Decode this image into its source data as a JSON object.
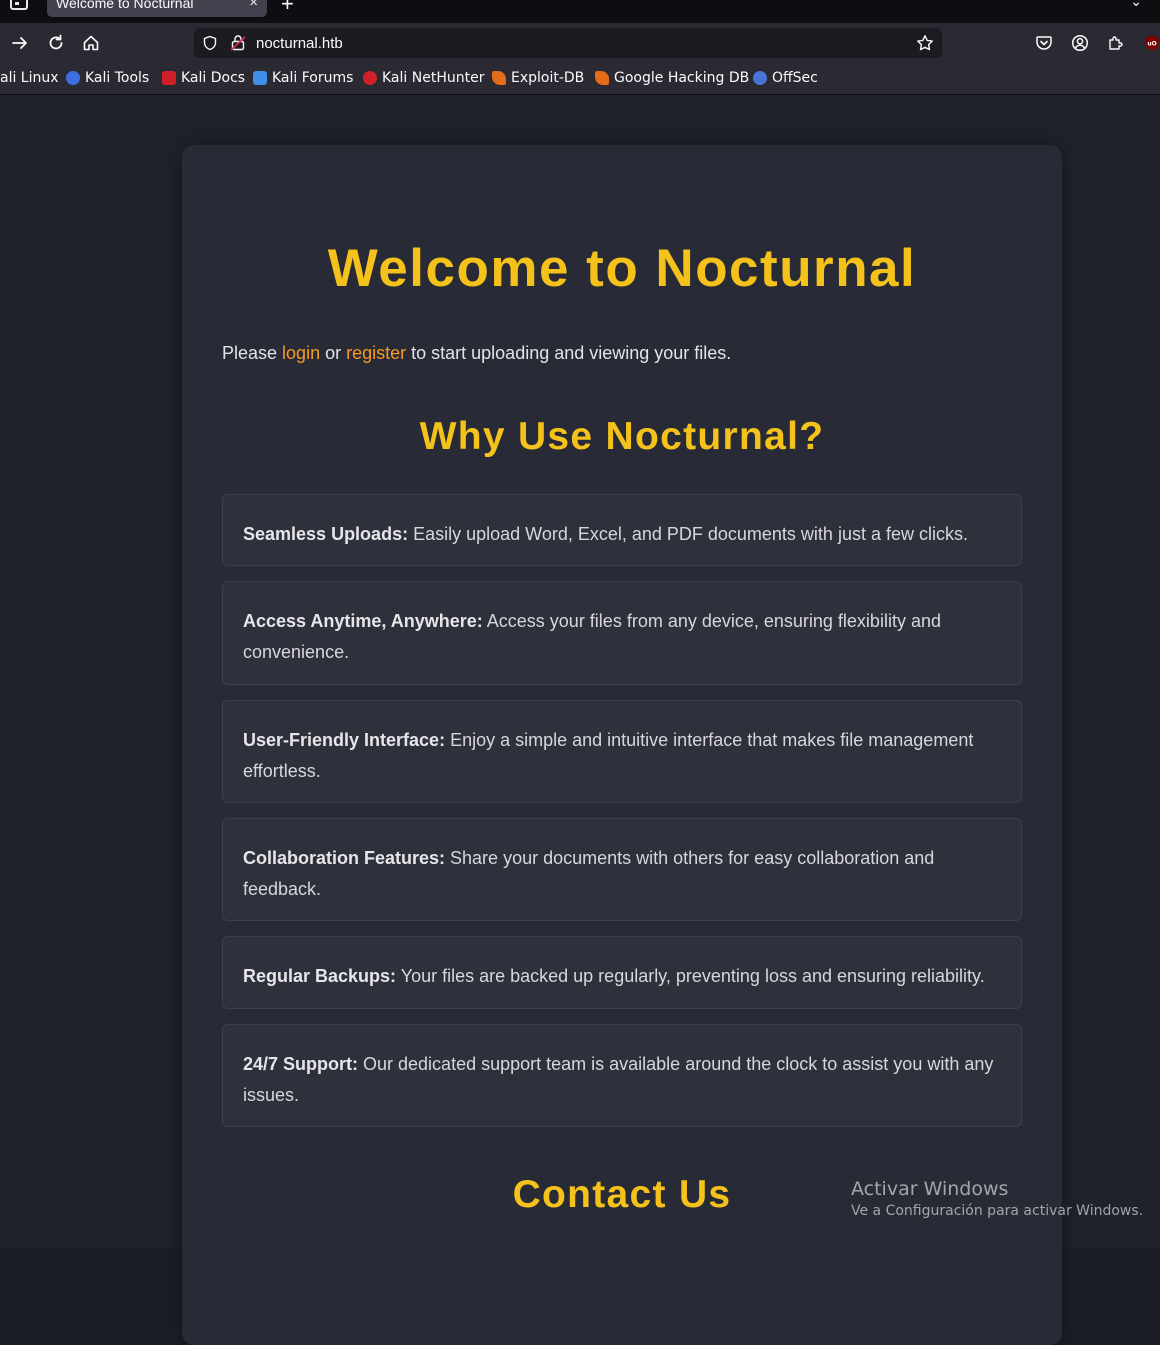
{
  "browser": {
    "tab_title": "Welcome to Nocturnal",
    "tab_close": "×",
    "new_tab": "+",
    "tab_list": "⌄",
    "url": "nocturnal.htb",
    "bookmarks": [
      {
        "label": "ali Linux",
        "icon": "kali-linux-icon",
        "color": "#2b2a33"
      },
      {
        "label": "Kali Tools",
        "icon": "kali-tools-icon",
        "color": "#3d6fe0"
      },
      {
        "label": "Kali Docs",
        "icon": "kali-docs-icon",
        "color": "#d0202a"
      },
      {
        "label": "Kali Forums",
        "icon": "kali-forums-icon",
        "color": "#3f8fe8"
      },
      {
        "label": "Kali NetHunter",
        "icon": "kali-nethunter-icon",
        "color": "#d0202a"
      },
      {
        "label": "Exploit-DB",
        "icon": "exploit-db-icon",
        "color": "#e46b18"
      },
      {
        "label": "Google Hacking DB",
        "icon": "ghdb-icon",
        "color": "#e46b18"
      },
      {
        "label": "OffSec",
        "icon": "offsec-icon",
        "color": "#4a74d6"
      }
    ]
  },
  "page": {
    "title": "Welcome to Nocturnal",
    "intro_before": "Please ",
    "login_link": "login",
    "intro_middle": " or ",
    "register_link": "register",
    "intro_after": " to start uploading and viewing your files.",
    "why_title": "Why Use Nocturnal?",
    "features": [
      {
        "title": "Seamless Uploads:",
        "text": " Easily upload Word, Excel, and PDF documents with just a few clicks."
      },
      {
        "title": "Access Anytime, Anywhere:",
        "text": " Access your files from any device, ensuring flexibility and convenience."
      },
      {
        "title": "User-Friendly Interface:",
        "text": " Enjoy a simple and intuitive interface that makes file management effortless."
      },
      {
        "title": "Collaboration Features:",
        "text": " Share your documents with others for easy collaboration and feedback."
      },
      {
        "title": "Regular Backups:",
        "text": " Your files are backed up regularly, preventing loss and ensuring reliability."
      },
      {
        "title": "24/7 Support:",
        "text": " Our dedicated support team is available around the clock to assist you with any issues."
      }
    ],
    "contact_title": "Contact Us"
  },
  "watermark": {
    "title": "Activar Windows",
    "subtitle": "Ve a Configuración para activar Windows."
  },
  "colors": {
    "accent": "#f4c21a",
    "link": "#f59a23",
    "card": "#282b35",
    "feature_bg": "#2e313b"
  }
}
